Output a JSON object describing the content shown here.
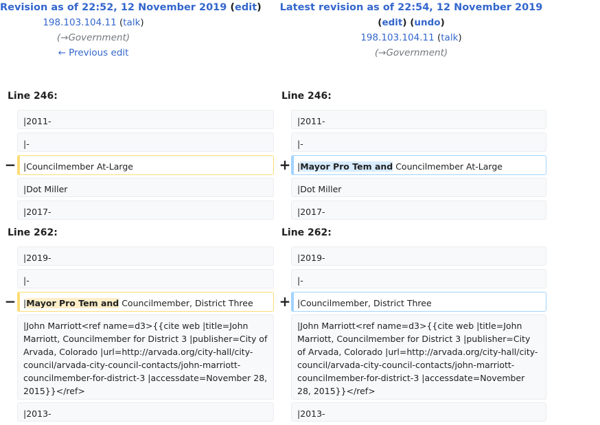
{
  "left_header": {
    "title": "Revision as of 22:52, 12 November 2019",
    "edit": "edit",
    "user": "198.103.104.11",
    "talk": "talk",
    "comment": "(→Government)",
    "prev": "← Previous edit"
  },
  "right_header": {
    "title": "Latest revision as of 22:54, 12 November 2019",
    "edit": "edit",
    "undo": "undo",
    "user": "198.103.104.11",
    "talk": "talk",
    "comment": "(→Government)"
  },
  "block1": {
    "line_label": "Line 246:",
    "left": [
      "|2011-",
      "|-",
      "|Dot Miller",
      "|2017-"
    ],
    "right": [
      "|2011-",
      "|-",
      "|Dot Miller",
      "|2017-"
    ],
    "changed_left": "|Councilmember At-Large",
    "changed_right_pre": "|",
    "changed_right_hl": "Mayor Pro Tem and",
    "changed_right_post": " Councilmember At-Large"
  },
  "block2": {
    "line_label": "Line 262:",
    "left": [
      "|2019-",
      "|-"
    ],
    "right": [
      "|2019-",
      "|-"
    ],
    "changed_left_pre": "|",
    "changed_left_hl": "Mayor Pro Tem and",
    "changed_left_post": " Councilmember, District Three",
    "changed_right": "|Councilmember, District Three",
    "ref": "|John Marriott<ref name=d3>{{cite web |title=John Marriott, Councilmember for District 3 |publisher=City of Arvada, Colorado |url=http://arvada.org/city-hall/city-council/arvada-city-council-contacts/john-marriott-councilmember-for-district-3 |accessdate=November 28, 2015}}</ref>",
    "last": "|2013-"
  },
  "markers": {
    "minus": "−",
    "plus": "+"
  }
}
